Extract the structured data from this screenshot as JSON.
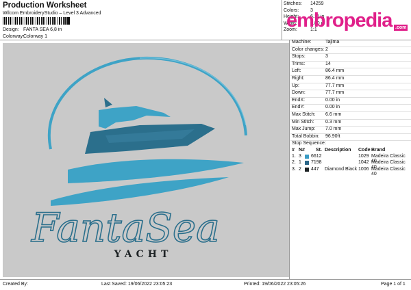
{
  "header": {
    "title": "Production Worksheet",
    "subtitle": "Wilcom EmbroideryStudio – Level 3 Advanced"
  },
  "design": {
    "design_label": "Design:",
    "design_value": "FANTA SEA 6,8 in",
    "colorway_label": "Colorway:",
    "colorway_value": "Colorway 1"
  },
  "stats": [
    {
      "k": "Stitches:",
      "v": "14259"
    },
    {
      "k": "Colors:",
      "v": "3"
    },
    {
      "k": "Height:",
      "v": "6.11 in"
    },
    {
      "k": "Width:",
      "v": "6.80 in"
    },
    {
      "k": "Zoom:",
      "v": "1:1"
    }
  ],
  "brand": {
    "logo": "embropedia",
    "logo_suffix": ".com",
    "logo_color": "#e0208a"
  },
  "design_art": {
    "script_text": "FantaSea",
    "caption_text": "YACHT",
    "primary_color": "#3ea3c6",
    "secondary_color": "#2b6f8c",
    "background_color": "#c9c9c9"
  },
  "details": [
    {
      "k": "Machine:",
      "v": "Tajima"
    },
    {
      "k": "Color changes:",
      "v": "2"
    },
    {
      "k": "Stops:",
      "v": "3"
    },
    {
      "k": "Trims:",
      "v": "14"
    },
    {
      "k": "Left:",
      "v": "86.4 mm"
    },
    {
      "k": "Right:",
      "v": "86.4 mm"
    },
    {
      "k": "Up:",
      "v": "77.7 mm"
    },
    {
      "k": "Down:",
      "v": "77.7 mm"
    },
    {
      "k": "EndX:",
      "v": "0.00 in"
    },
    {
      "k": "EndY:",
      "v": "0.00 in"
    },
    {
      "k": "Max Stitch:",
      "v": "6.6 mm"
    },
    {
      "k": "Min Stitch:",
      "v": "0.3 mm"
    },
    {
      "k": "Max Jump:",
      "v": "7.0 mm"
    },
    {
      "k": "Total Bobbin:",
      "v": "96.90ft"
    }
  ],
  "stop_sequence": {
    "label": "Stop Sequence:",
    "headers": [
      "#",
      "N#",
      "St.",
      "Description",
      "Code",
      "Brand"
    ],
    "rows": [
      {
        "n": "1.",
        "nn": "3",
        "color": "#3a9bc4",
        "st": "6612",
        "desc": "",
        "code": "1029",
        "brand": "Madeira Classic 40"
      },
      {
        "n": "2.",
        "nn": "1",
        "color": "#2a6688",
        "st": "7198",
        "desc": "",
        "code": "1042",
        "brand": "Madeira Classic 40"
      },
      {
        "n": "3.",
        "nn": "2",
        "color": "#1d2224",
        "st": "447",
        "desc": "Diamond Black",
        "code": "1006",
        "brand": "Madeira Classic 40"
      }
    ]
  },
  "footer": {
    "created_by": "Created By:",
    "last_saved": "Last Saved: 19/06/2022 23:05:23",
    "printed": "Printed: 19/06/2022 23:05:26",
    "page": "Page 1 of 1"
  }
}
